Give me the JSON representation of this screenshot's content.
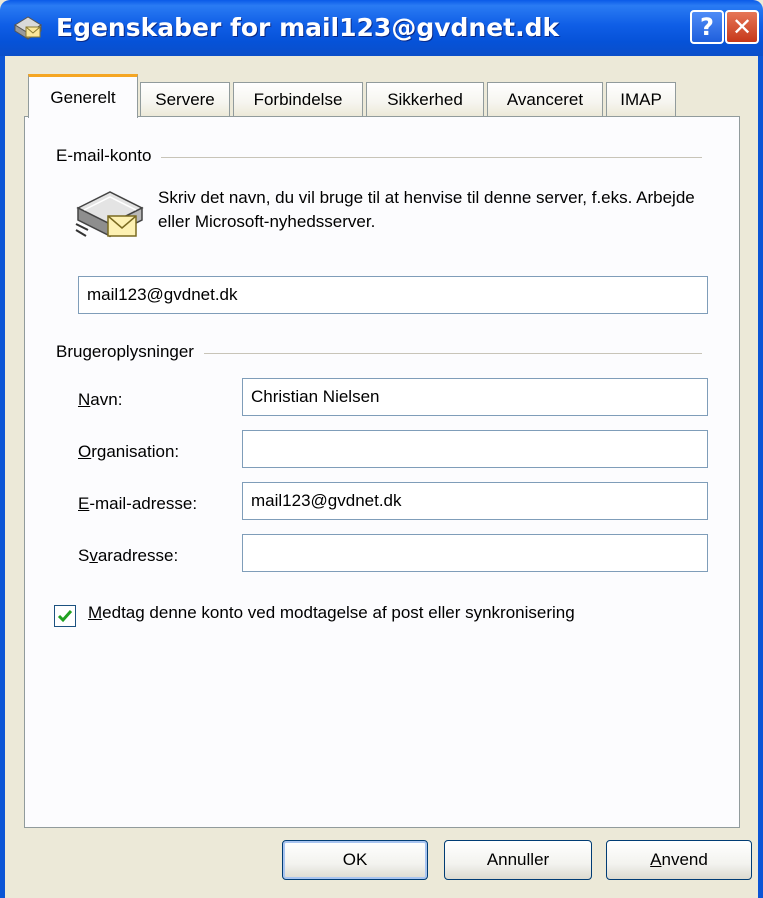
{
  "window": {
    "title": "Egenskaber for mail123@gvdnet.dk",
    "help_label": "?",
    "close_label": "✕"
  },
  "tabs": [
    {
      "label": "Generelt",
      "active": true
    },
    {
      "label": "Servere",
      "active": false
    },
    {
      "label": "Forbindelse",
      "active": false
    },
    {
      "label": "Sikkerhed",
      "active": false
    },
    {
      "label": "Avanceret",
      "active": false
    },
    {
      "label": "IMAP",
      "active": false
    }
  ],
  "account": {
    "group_label": "E-mail-konto",
    "description": "Skriv det navn, du vil bruge til at henvise til denne server, f.eks. Arbejde eller Microsoft-nyhedsserver.",
    "name_value": "mail123@gvdnet.dk",
    "icon": "mail-server-icon"
  },
  "user_info": {
    "group_label": "Brugeroplysninger",
    "name_label_u": "N",
    "name_label_rest": "avn:",
    "name_value": "Christian Nielsen",
    "org_label_u": "O",
    "org_label_rest": "rganisation:",
    "org_value": "",
    "email_label_u": "E",
    "email_label_rest": "-mail-adresse:",
    "email_value": "mail123@gvdnet.dk",
    "reply_label_pre": "S",
    "reply_label_u": "v",
    "reply_label_rest": "aradresse:",
    "reply_value": ""
  },
  "include_account": {
    "checked": true,
    "label_u": "M",
    "label_rest": "edtag denne konto ved modtagelse af post eller synkronisering"
  },
  "buttons": {
    "ok": "OK",
    "cancel": "Annuller",
    "apply_u": "A",
    "apply_rest": "nvend"
  },
  "colors": {
    "titlebar": "#0b55d6",
    "active_tab_accent": "#f5a623",
    "dialog_bg": "#ece9d8"
  }
}
